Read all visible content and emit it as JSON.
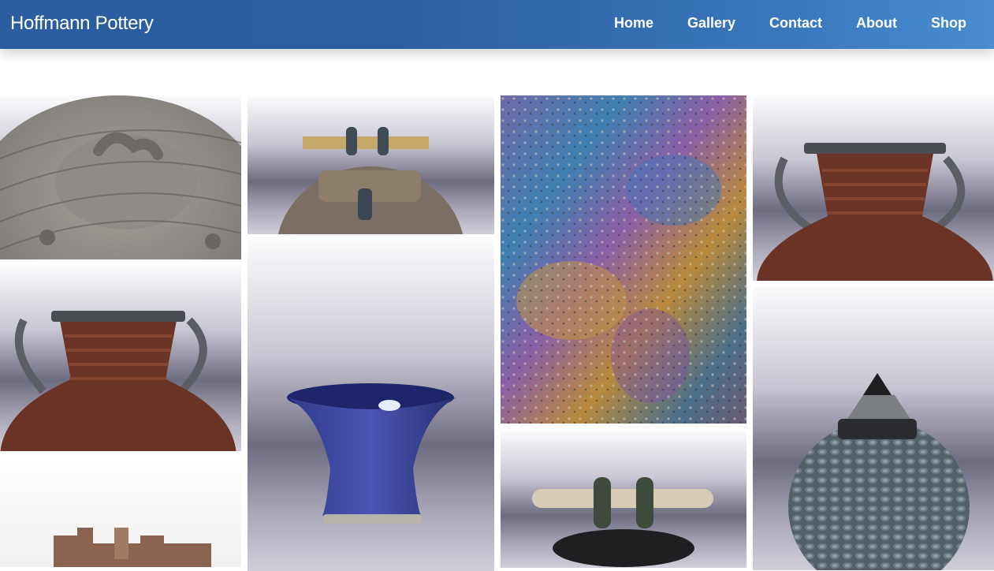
{
  "header": {
    "brand": "Hoffmann Pottery",
    "nav": [
      {
        "label": "Home"
      },
      {
        "label": "Gallery"
      },
      {
        "label": "Contact"
      },
      {
        "label": "About"
      },
      {
        "label": "Shop"
      }
    ],
    "colors": {
      "bar_start": "#2a5ea0",
      "bar_end": "#4a8cd0",
      "text": "#ffffff"
    }
  },
  "gallery": {
    "items": [
      {
        "subject": "grey textured lid with coiled knob"
      },
      {
        "subject": "raku lidded jar top with bamboo handle"
      },
      {
        "subject": "iridescent raku surface close-up"
      },
      {
        "subject": "rust-glazed amphora with two handles"
      },
      {
        "subject": "rust-glazed amphora with two handles"
      },
      {
        "subject": "cobalt blue flared bowl"
      },
      {
        "subject": "black lidded jar with bamboo handle"
      },
      {
        "subject": "iridescent textured lidded jar"
      },
      {
        "subject": "wooden stand object"
      }
    ]
  }
}
